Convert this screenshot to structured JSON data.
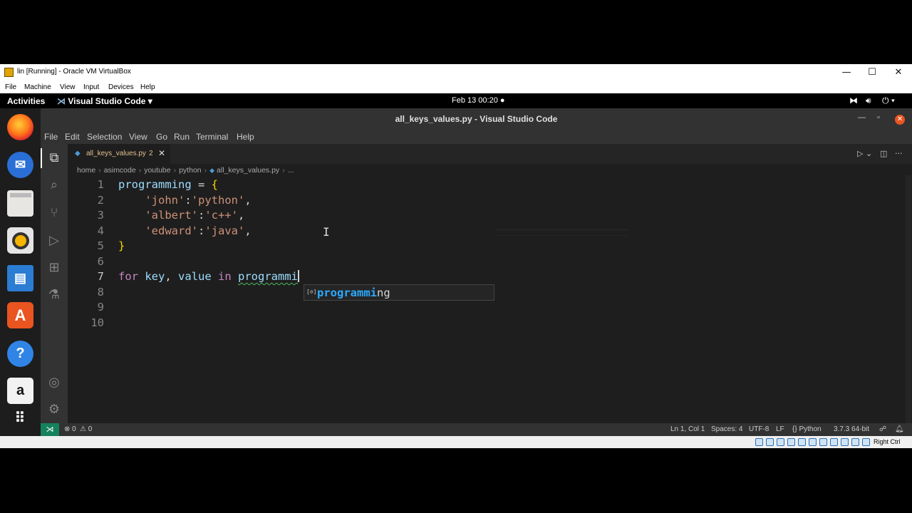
{
  "vbox": {
    "title": "lin [Running] - Oracle VM VirtualBox",
    "menu": [
      "File",
      "Machine",
      "View",
      "Input",
      "Devices",
      "Help"
    ],
    "hostkey": "Right Ctrl"
  },
  "gnome": {
    "activities": "Activities",
    "app_menu": "Visual Studio Code ▾",
    "clock": "Feb 13  00:20 ●"
  },
  "vscode": {
    "window_title": "all_keys_values.py - Visual Studio Code",
    "menu": [
      "File",
      "Edit",
      "Selection",
      "View",
      "Go",
      "Run",
      "Terminal",
      "Help"
    ],
    "tab": {
      "filename": "all_keys_values.py",
      "problems": "2"
    },
    "breadcrumb": [
      "home",
      "asimcode",
      "youtube",
      "python",
      "all_keys_values.py",
      "..."
    ],
    "line_numbers": [
      "1",
      "2",
      "3",
      "4",
      "5",
      "6",
      "7",
      "8",
      "9",
      "10"
    ],
    "code": {
      "l1_var": "programming",
      "l1_op": " = ",
      "l1_brace": "{",
      "l2_indent": "    ",
      "l2_key": "'john'",
      "l2_colon": ":",
      "l2_val": "'python'",
      "l2_end": ",",
      "l3_indent": "    ",
      "l3_key": "'albert'",
      "l3_colon": ":",
      "l3_val": "'c++'",
      "l3_end": ",",
      "l4_indent": "    ",
      "l4_key": "'edward'",
      "l4_colon": ":",
      "l4_val": "'java'",
      "l4_end": ",",
      "l5_brace": "}",
      "l7_for": "for",
      "l7_key": " key",
      "l7_comma": ",",
      "l7_value": " value",
      "l7_in": " in",
      "l7_space": " ",
      "l7_partial": "programmi"
    },
    "suggestion": {
      "icon": "[⊙]",
      "match": "programmi",
      "rest": "ng"
    },
    "status": {
      "errors": "⊗ 0",
      "warnings": "⚠ 0",
      "position": "Ln 1, Col 1",
      "spaces": "Spaces: 4",
      "encoding": "UTF-8",
      "eol": "LF",
      "language": "{} Python",
      "interpreter": "3.7.3 64-bit"
    }
  },
  "colors": {
    "editor_bg": "#1e1e1e",
    "remote_indicator": "#16825d",
    "ubuntu_orange": "#e95420",
    "suggest_highlight": "#2aaaff"
  }
}
